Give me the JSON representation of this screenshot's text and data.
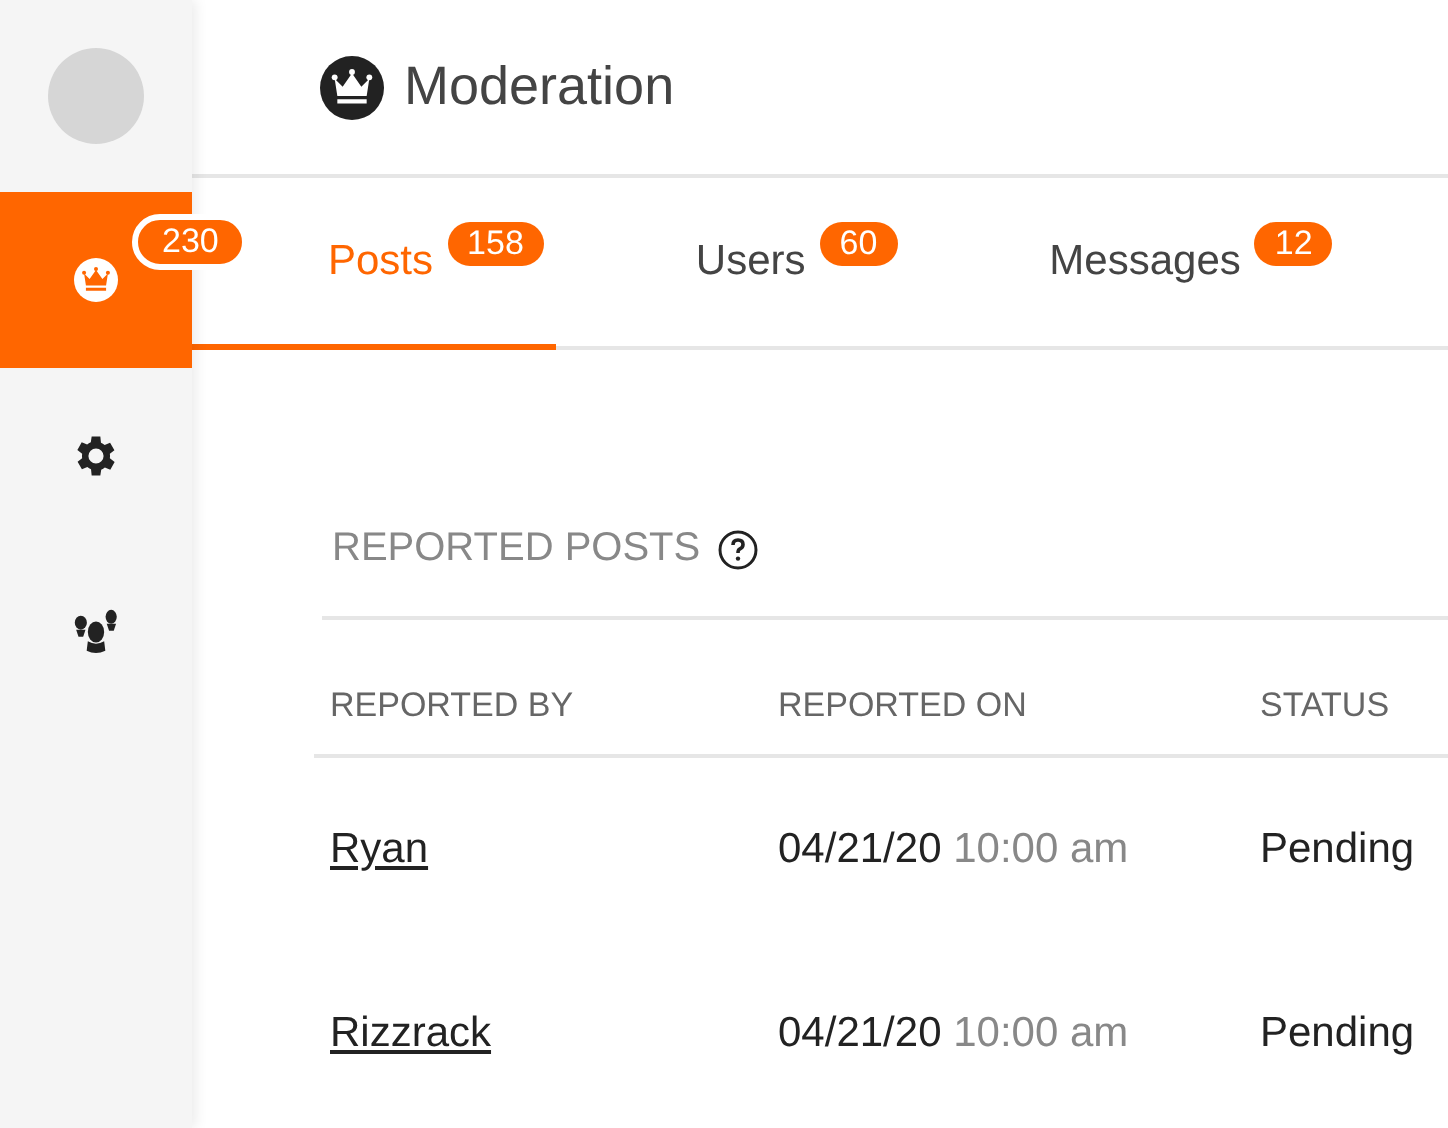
{
  "sidebar": {
    "items": [
      {
        "kind": "crown",
        "selected": true,
        "badge": "230"
      },
      {
        "kind": "gear",
        "selected": false
      },
      {
        "kind": "people",
        "selected": false
      }
    ]
  },
  "header": {
    "title": "Moderation"
  },
  "tabs": [
    {
      "label": "Posts",
      "count": "158",
      "selected": true
    },
    {
      "label": "Users",
      "count": "60",
      "selected": false
    },
    {
      "label": "Messages",
      "count": "12",
      "selected": false
    }
  ],
  "section": {
    "title": "REPORTED POSTS"
  },
  "table": {
    "columns": [
      "REPORTED BY",
      "REPORTED ON",
      "STATUS"
    ],
    "rows": [
      {
        "reported_by": "Ryan",
        "date": "04/21/20",
        "time": "10:00 am",
        "status": "Pending"
      },
      {
        "reported_by": "Rizzrack",
        "date": "04/21/20",
        "time": "10:00 am",
        "status": "Pending"
      }
    ]
  }
}
